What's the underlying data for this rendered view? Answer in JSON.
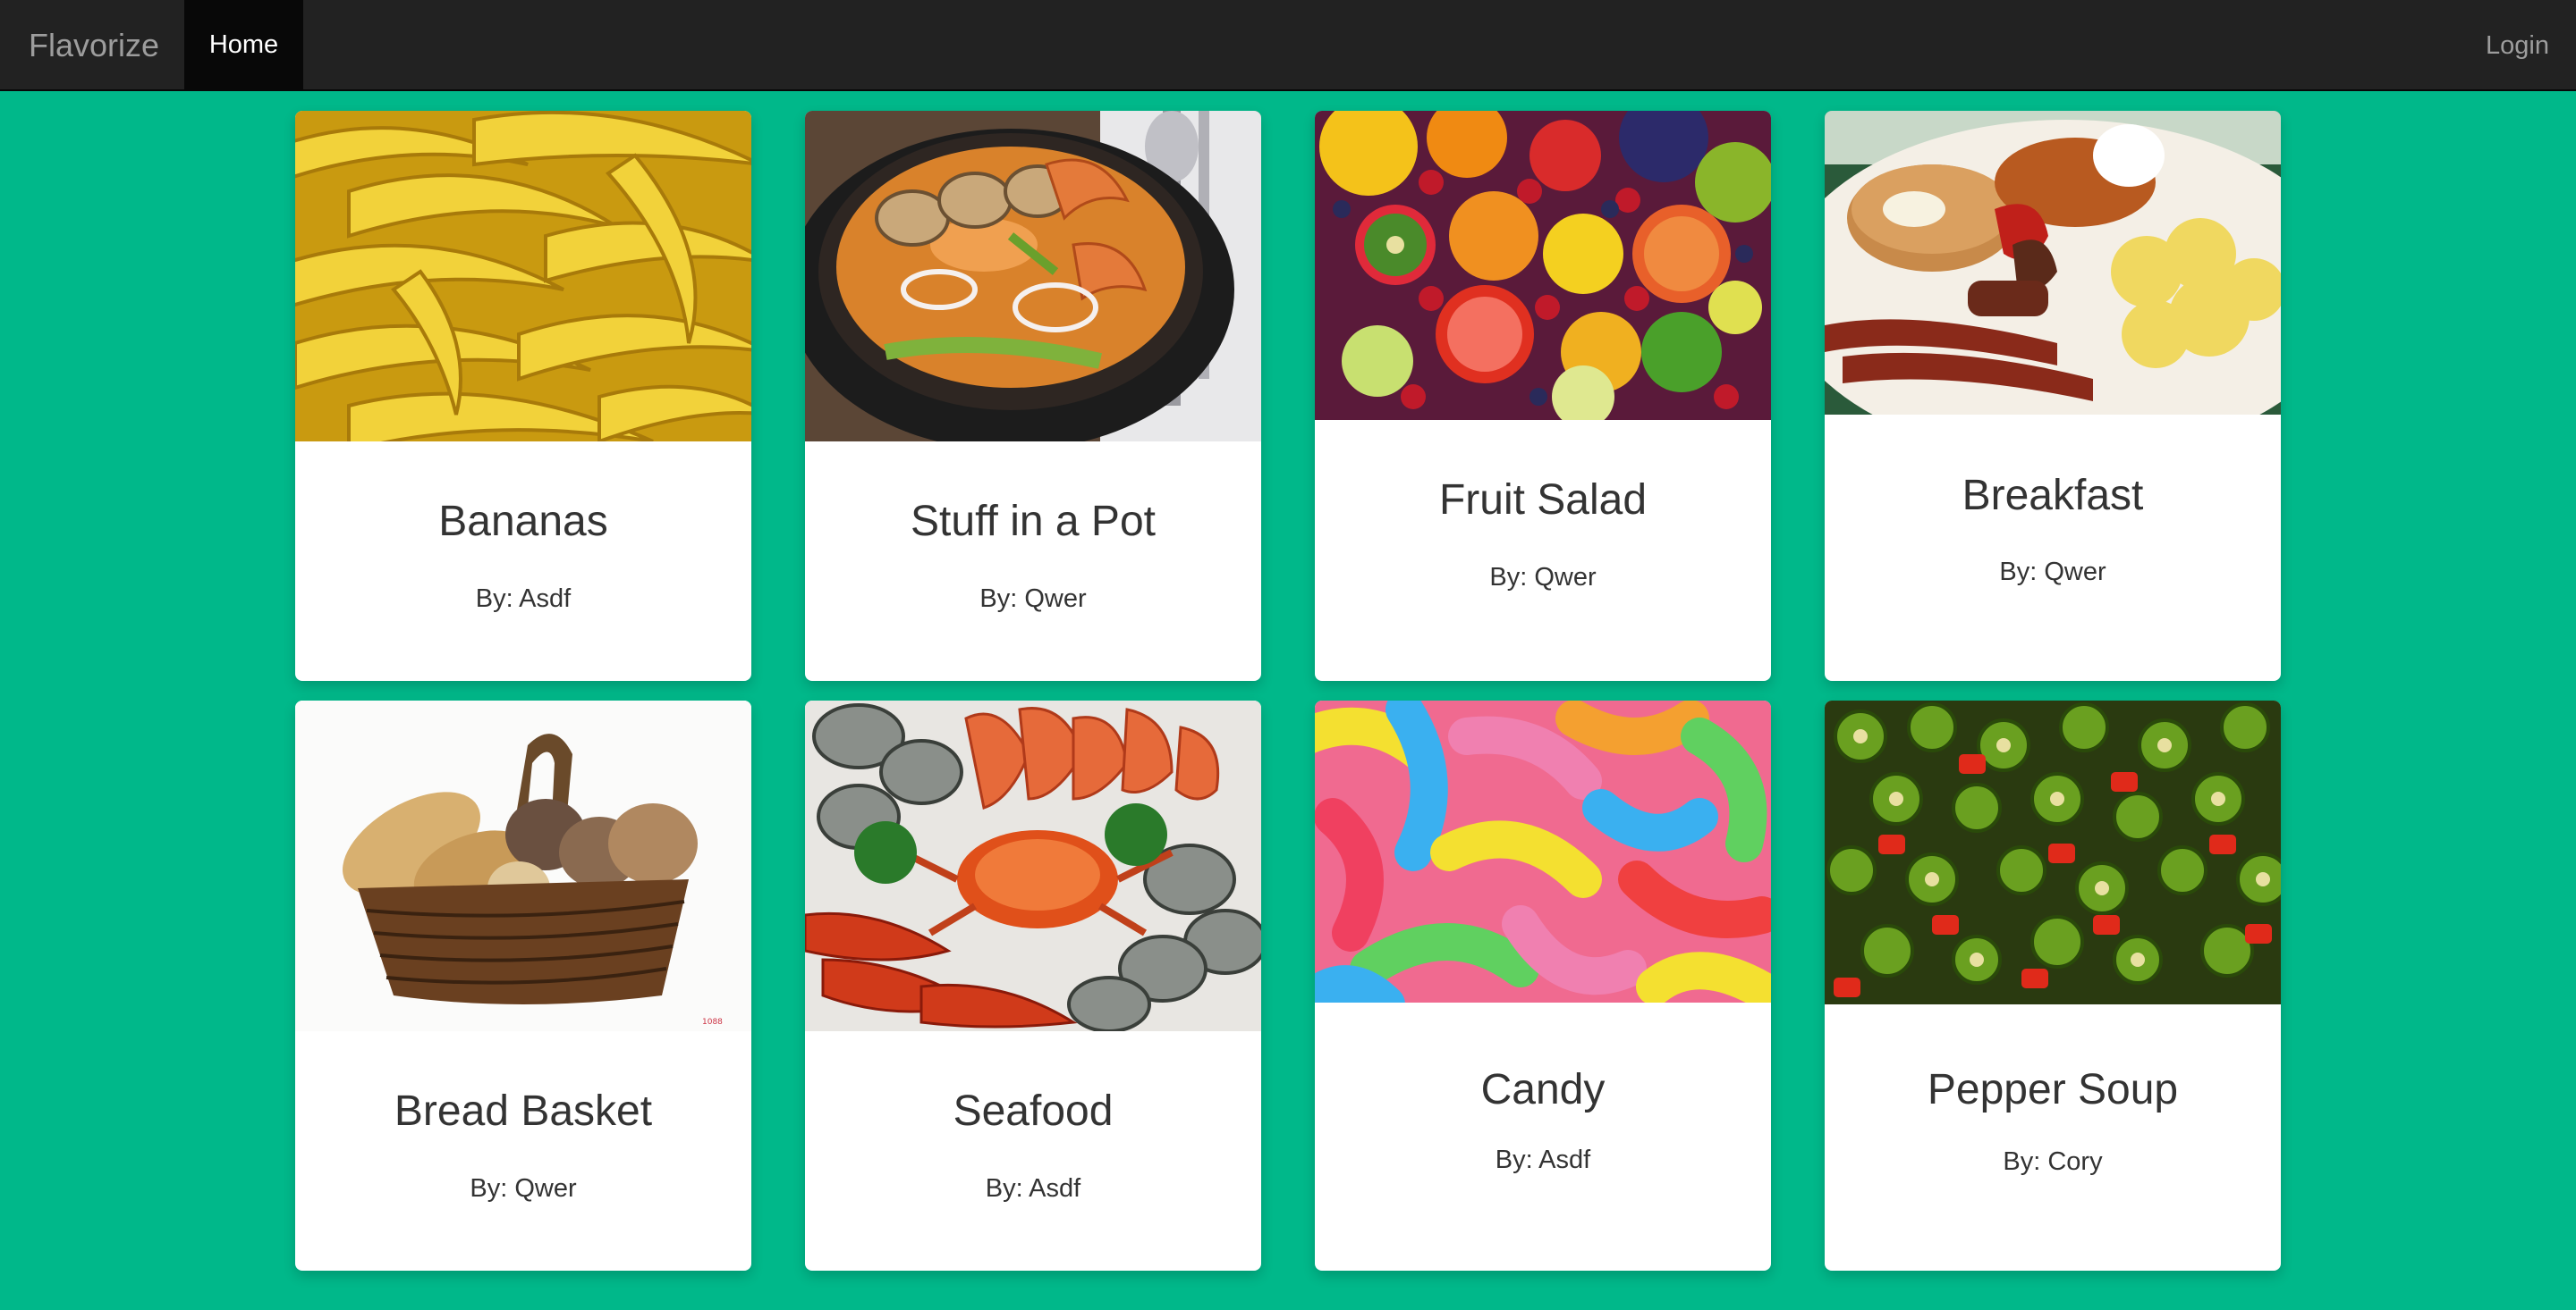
{
  "navbar": {
    "brand": "Flavorize",
    "home_label": "Home",
    "login_label": "Login"
  },
  "recipes": [
    {
      "title": "Bananas",
      "author": "By: Asdf",
      "image": "bananas-photo"
    },
    {
      "title": "Stuff in a Pot",
      "author": "By: Qwer",
      "image": "seafood-pot-photo"
    },
    {
      "title": "Fruit Salad",
      "author": "By: Qwer",
      "image": "fruit-photo"
    },
    {
      "title": "Breakfast",
      "author": "By: Qwer",
      "image": "breakfast-photo"
    },
    {
      "title": "Bread Basket",
      "author": "By: Qwer",
      "image": "bread-basket-photo"
    },
    {
      "title": "Seafood",
      "author": "By: Asdf",
      "image": "seafood-platter-photo"
    },
    {
      "title": "Candy",
      "author": "By: Asdf",
      "image": "gummy-worms-photo"
    },
    {
      "title": "Pepper Soup",
      "author": "By: Cory",
      "image": "peppers-photo"
    }
  ],
  "colors": {
    "background": "#00b88a",
    "navbar": "#222222",
    "active_nav": "#080808",
    "card": "#ffffff",
    "text": "#333333"
  }
}
